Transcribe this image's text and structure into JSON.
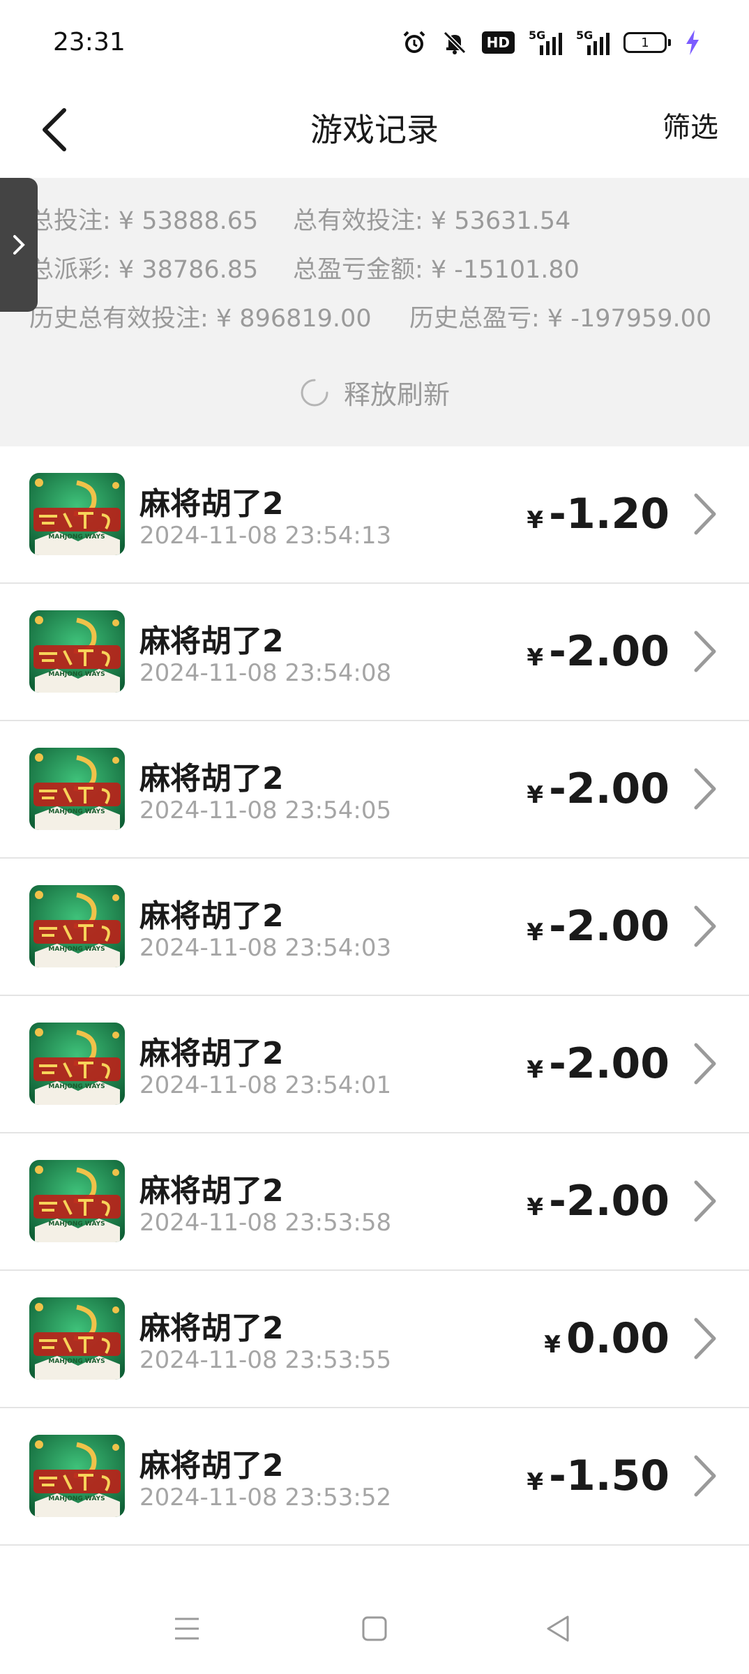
{
  "status_bar": {
    "time": "23:31",
    "icons": [
      "alarm-icon",
      "bell-muted-icon",
      "hd-icon",
      "signal-5g-icon",
      "signal-5g-icon",
      "battery-icon",
      "charging-icon"
    ],
    "hd_label": "HD",
    "signal1_label": "5G",
    "signal2_label": "5G",
    "battery_level": "1"
  },
  "header": {
    "title": "游戏记录",
    "filter_label": "筛选"
  },
  "summary": {
    "row1": [
      {
        "label": "总投注: ¥ 53888.65"
      },
      {
        "label": "总有效投注: ¥ 53631.54"
      }
    ],
    "row2": [
      {
        "label": "总派彩: ¥ 38786.85"
      },
      {
        "label": "总盈亏金额: ¥ -15101.80"
      }
    ],
    "row3": [
      {
        "label": "历史总有效投注: ¥ 896819.00"
      },
      {
        "label": "历史总盈亏: ¥ -197959.00"
      }
    ],
    "refresh_text": "释放刷新"
  },
  "records": [
    {
      "name": "麻将胡了2",
      "time": "2024-11-08 23:54:13",
      "currency": "¥",
      "amount": "-1.20"
    },
    {
      "name": "麻将胡了2",
      "time": "2024-11-08 23:54:08",
      "currency": "¥",
      "amount": "-2.00"
    },
    {
      "name": "麻将胡了2",
      "time": "2024-11-08 23:54:05",
      "currency": "¥",
      "amount": "-2.00"
    },
    {
      "name": "麻将胡了2",
      "time": "2024-11-08 23:54:03",
      "currency": "¥",
      "amount": "-2.00"
    },
    {
      "name": "麻将胡了2",
      "time": "2024-11-08 23:54:01",
      "currency": "¥",
      "amount": "-2.00"
    },
    {
      "name": "麻将胡了2",
      "time": "2024-11-08 23:53:58",
      "currency": "¥",
      "amount": "-2.00"
    },
    {
      "name": "麻将胡了2",
      "time": "2024-11-08 23:53:55",
      "currency": "¥",
      "amount": "0.00"
    },
    {
      "name": "麻将胡了2",
      "time": "2024-11-08 23:53:52",
      "currency": "¥",
      "amount": "-1.50"
    }
  ],
  "game_logo_text": "MAHJONG WAYS",
  "colors": {
    "summary_bg": "#f2f2f2",
    "text_gray": "#9a9a9a",
    "thumb_green": "#1f8a4a",
    "thumb_gold": "#e8b53a",
    "charge": "#7b5cff"
  }
}
